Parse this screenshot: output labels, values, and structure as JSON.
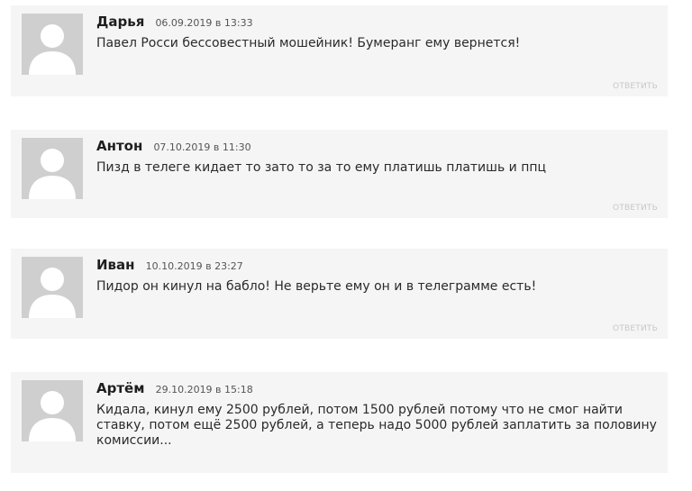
{
  "comments": [
    {
      "author": "Дарья",
      "date": "06.09.2019 в 13:33",
      "text": "Павел Росси бессовестный мошейник! Бумеранг ему вернется!",
      "reply_label": "ОТВЕТИТЬ"
    },
    {
      "author": "Антон",
      "date": "07.10.2019 в 11:30",
      "text": "Пизд в телеге кидает то зато то за то ему платишь платишь и ппц",
      "reply_label": "ОТВЕТИТЬ"
    },
    {
      "author": "Иван",
      "date": "10.10.2019 в 23:27",
      "text": "Пидор он кинул на бабло! Не верьте ему он и в телеграмме есть!",
      "reply_label": "ОТВЕТИТЬ"
    },
    {
      "author": "Артём",
      "date": "29.10.2019 в 15:18",
      "text": "Кидала, кинул ему 2500 рублей, потом 1500 рублей потому что не смог найти ставку, потом ещё 2500 рублей, а теперь надо 5000 рублей заплатить за половину комиссии..."
    }
  ],
  "icons": {
    "avatar": "default-user-avatar-icon"
  },
  "colors": {
    "card_background": "#f5f5f5",
    "avatar_background": "#cfcfcf",
    "avatar_figure": "#ffffff",
    "reply_text": "#c8c8c8"
  }
}
